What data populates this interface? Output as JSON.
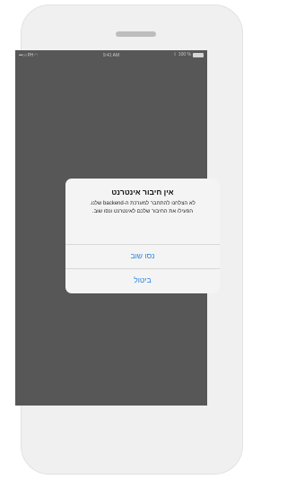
{
  "status_bar": {
    "carrier": "•••○○ PH",
    "time": "9:41 AM",
    "battery_text": "100 %",
    "icons": [
      "signal-icon",
      "wifi-icon",
      "bluetooth-icon",
      "battery-icon"
    ]
  },
  "dialog": {
    "title": "אין חיבור אינטרנט",
    "message_line1": "לא הצלחנו להתחבר למערכת ה-backend שלנו.",
    "message_line2": "הפעילו את החיבור שלכם לאינטרנט ונסו שוב.",
    "retry_label": "נסו שוב",
    "cancel_label": "ביטול",
    "button_color": "#2d86e0"
  },
  "colors": {
    "screen_background": "#575757",
    "dialog_background": "#f4f4f4",
    "device_frame": "#f0f0f0"
  }
}
